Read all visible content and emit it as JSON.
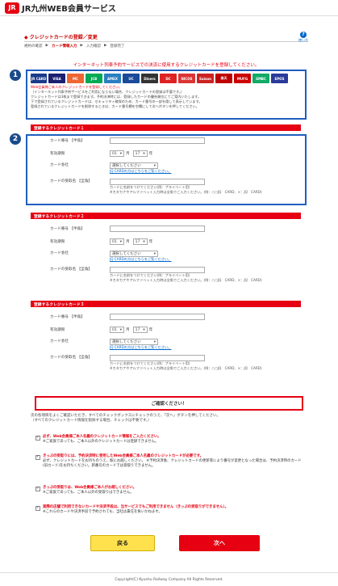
{
  "header": {
    "logo_mark": "JR",
    "site_title": "JR九州WEB会員サービス"
  },
  "page": {
    "title": "クレジットカードの登録／変更",
    "help_label": "使い方",
    "steps": [
      "規約の確認",
      "カード情報入力",
      "入力確認",
      "登録完了"
    ],
    "active_step": 1,
    "notice": "インターネット列車予約サービスでの決済に使用するクレジットカードを登録してください。"
  },
  "callouts": {
    "one": "1",
    "two": "2"
  },
  "card_brands": [
    {
      "name": "JR CARD",
      "color": "#1a3a8a"
    },
    {
      "name": "VISA",
      "color": "#1a1f71"
    },
    {
      "name": "MC",
      "color": "#e63"
    },
    {
      "name": "JCB",
      "color": "#0a5"
    },
    {
      "name": "AMEX",
      "color": "#2a7fc1"
    },
    {
      "name": "UC",
      "color": "#1a4a9a"
    },
    {
      "name": "Diners",
      "color": "#333"
    },
    {
      "name": "DC",
      "color": "#d22"
    },
    {
      "name": "NICOS",
      "color": "#d33"
    },
    {
      "name": "Saison",
      "color": "#c22"
    },
    {
      "name": "楽天",
      "color": "#bf0000"
    },
    {
      "name": "MUFG",
      "color": "#c00"
    },
    {
      "name": "SMBC",
      "color": "#1a6"
    },
    {
      "name": "EPOS",
      "color": "#2a3a9a"
    }
  ],
  "info_lines": [
    {
      "text": "Web会員様ご本人のクレジットカードを登録してください。",
      "red": true
    },
    {
      "text": "（インターネット列車予約サービスをご利用にならない場合、クレジットカードの登録は不要です。）",
      "red": false
    },
    {
      "text": "クレジットカードは3枚まで登録できます。予約決済時には、登録したカードの優先順位にてご案内いたします。",
      "red": false
    },
    {
      "text": "下で登録されているクレジットカードは、セキュリティ確保のため、カード番号の一部を隠して表示しています。",
      "red": false
    },
    {
      "text": "登録されているクレジットカードを削除するときは、カード番号欄を空欄にして次へボタンを押してください。",
      "red": false
    }
  ],
  "sections": [
    {
      "title": "登録するクレジットカード１"
    },
    {
      "title": "登録するクレジットカード２"
    },
    {
      "title": "登録するクレジットカード３"
    }
  ],
  "form": {
    "card_number_label": "カード番号",
    "half_width": "【半角】",
    "full_width": "【全角】",
    "expiry_label": "有効期限",
    "month_value": "01",
    "month_suffix": "月",
    "year_value": "17",
    "year_suffix": "年",
    "company_label": "カード会社",
    "company_select": "選択してください",
    "company_link": "JQ CARDの方はこちらをご覧ください。",
    "holder_label": "カードの受取名",
    "holder_help1": "カードに名前をつけてください(例：プライベート用)",
    "holder_help2": "※カタカナやアルファベット入力時は全角でご入力ください。(例：○○JQ　CARD、×：JQ　CARD)"
  },
  "confirm": {
    "title": "ご確認ください！",
    "intro1": "次の各項目をよくご確認いただき、すべてのチェックボックスにチェックのうえ、「次へ」ボタンを押してください。",
    "intro2": "（すべてのクレジットカード情報を削除する場合、チェックは不要です。）",
    "items": [
      {
        "red": "必ず、Web会員様ご本人名義のクレジットカード情報をご入力ください。",
        "body": "※ご家族であっても、ご本人以外のクレジットカードは登録できません。"
      },
      {
        "red": "きっぷの受取りには、予約決済時に使用したWeb会員様ご本人名義のクレジットカードが必要です。",
        "body": "必ず、クレジットカードをお持ちのうえ、駅にお越しください。 ※予約決済後、クレジットカードの更新等により番号が変更となった場合は、予約決済時のカード(旧カード)をお持ちください。新番号のカードでは受取りできません。"
      },
      {
        "red": "きっぷの受取りは、Web会員様ご本人がお越しください。",
        "body": "※ご家族であっても、ご本人以外の受取りはできません。"
      },
      {
        "red": "実際の店舗で利用できないカードや決済手段は、当サービスでもご利用できません（きっぷの受取りができません）。",
        "body": "※これらのカードや決済手段で予約されても、当社は責任を負いかねます。"
      }
    ]
  },
  "buttons": {
    "back": "戻る",
    "next": "次へ"
  },
  "footer": {
    "copyright": "Copyright(C) Kyushu Railway Company All Rights Reserved."
  },
  "colors": {
    "accent": "#e60012",
    "callout": "#1a4a8a",
    "highlight": "#1f5fbf",
    "back_button": "#ffe14d",
    "next_button": "#e60012"
  }
}
